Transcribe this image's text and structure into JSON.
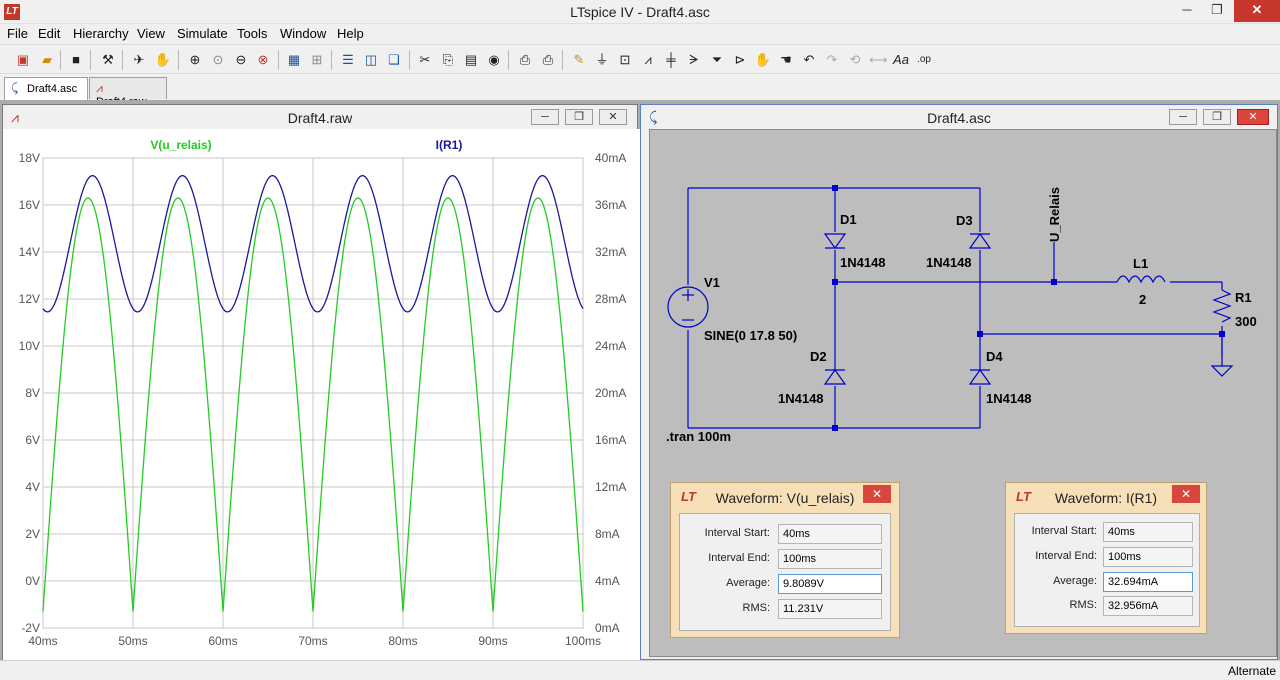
{
  "window": {
    "title": "LTspice IV - Draft4.asc",
    "minimize": "─",
    "restore": "❐",
    "close": "✕",
    "app_icon": "LT"
  },
  "menu": [
    "File",
    "Edit",
    "Hierarchy",
    "View",
    "Simulate",
    "Tools",
    "Window",
    "Help"
  ],
  "toolbar_icons": [
    "new-schematic-icon",
    "open-icon",
    "save-icon",
    "control-panel-icon",
    "run-icon",
    "halt-icon",
    "zoom-in-icon",
    "pan-icon",
    "zoom-out-icon",
    "zoom-fit-icon",
    "autorange-icon",
    "grid-icon",
    "tile-horizontal-icon",
    "tile-vertical-icon",
    "cascade-icon",
    "cut-icon",
    "copy-icon",
    "paste-icon",
    "find-icon",
    "print-setup-icon",
    "print-icon",
    "wire-icon",
    "ground-icon",
    "label-icon",
    "resistor-icon",
    "capacitor-icon",
    "inductor-icon",
    "diode-icon",
    "component-icon",
    "move-icon",
    "drag-icon",
    "undo-icon",
    "redo-icon",
    "rotate-icon",
    "mirror-icon",
    "text-icon",
    "spice-directive-icon"
  ],
  "tabs": [
    {
      "label": "Draft4.asc",
      "icon": "schematic-icon",
      "active": true
    },
    {
      "label": "Draft4.raw",
      "icon": "waveform-icon",
      "active": false
    }
  ],
  "plot_window": {
    "title": "Draft4.raw",
    "traces": [
      {
        "name": "V(u_relais)",
        "color": "#22cc22"
      },
      {
        "name": "I(R1)",
        "color": "#1a1a99"
      }
    ]
  },
  "chart_data": {
    "type": "line",
    "x_axis": {
      "ticks": [
        "40ms",
        "50ms",
        "60ms",
        "70ms",
        "80ms",
        "90ms",
        "100ms"
      ],
      "range": [
        40,
        100
      ]
    },
    "y_left": {
      "ticks": [
        "18V",
        "16V",
        "14V",
        "12V",
        "10V",
        "8V",
        "6V",
        "4V",
        "2V",
        "0V",
        "-2V"
      ],
      "range": [
        -2,
        18
      ]
    },
    "y_right": {
      "ticks": [
        "40mA",
        "36mA",
        "32mA",
        "28mA",
        "24mA",
        "20mA",
        "16mA",
        "12mA",
        "8mA",
        "4mA",
        "0mA"
      ],
      "range": [
        0,
        40
      ]
    },
    "grid": true,
    "series": [
      {
        "name": "V(u_relais)",
        "axis": "left",
        "shape": "full-wave-rectified-sine",
        "peak": 16.3,
        "trough": -1.3,
        "half_period_ms": 10,
        "first_min_ms": 40
      },
      {
        "name": "I(R1)",
        "axis": "right",
        "shape": "sine",
        "mean": 32.7,
        "amplitude": 5.8,
        "period_ms": 10,
        "first_max_ms": 45.5,
        "value_at_start": 30.8
      }
    ]
  },
  "schematic_window": {
    "title": "Draft4.asc",
    "labels": {
      "V1": "V1",
      "V1_val": "SINE(0 17.8 50)",
      "D1": "D1",
      "D1_val": "1N4148",
      "D2": "D2",
      "D2_val": "1N4148",
      "D3": "D3",
      "D3_val": "1N4148",
      "D4": "D4",
      "D4_val": "1N4148",
      "L1": "L1",
      "L1_val": "2",
      "R1": "R1",
      "R1_val": "300",
      "net": "U_Relais",
      "directive": ".tran 100m"
    }
  },
  "dialog_v": {
    "title": "Waveform: V(u_relais)",
    "rows": [
      {
        "label": "Interval Start:",
        "value": "40ms"
      },
      {
        "label": "Interval End:",
        "value": "100ms"
      },
      {
        "label": "Average:",
        "value": "9.8089V"
      },
      {
        "label": "RMS:",
        "value": "11.231V"
      }
    ]
  },
  "dialog_i": {
    "title": "Waveform: I(R1)",
    "rows": [
      {
        "label": "Interval Start:",
        "value": "40ms"
      },
      {
        "label": "Interval End:",
        "value": "100ms"
      },
      {
        "label": "Average:",
        "value": "32.694mA"
      },
      {
        "label": "RMS:",
        "value": "32.956mA"
      }
    ]
  },
  "status": {
    "text": "Alternate"
  }
}
